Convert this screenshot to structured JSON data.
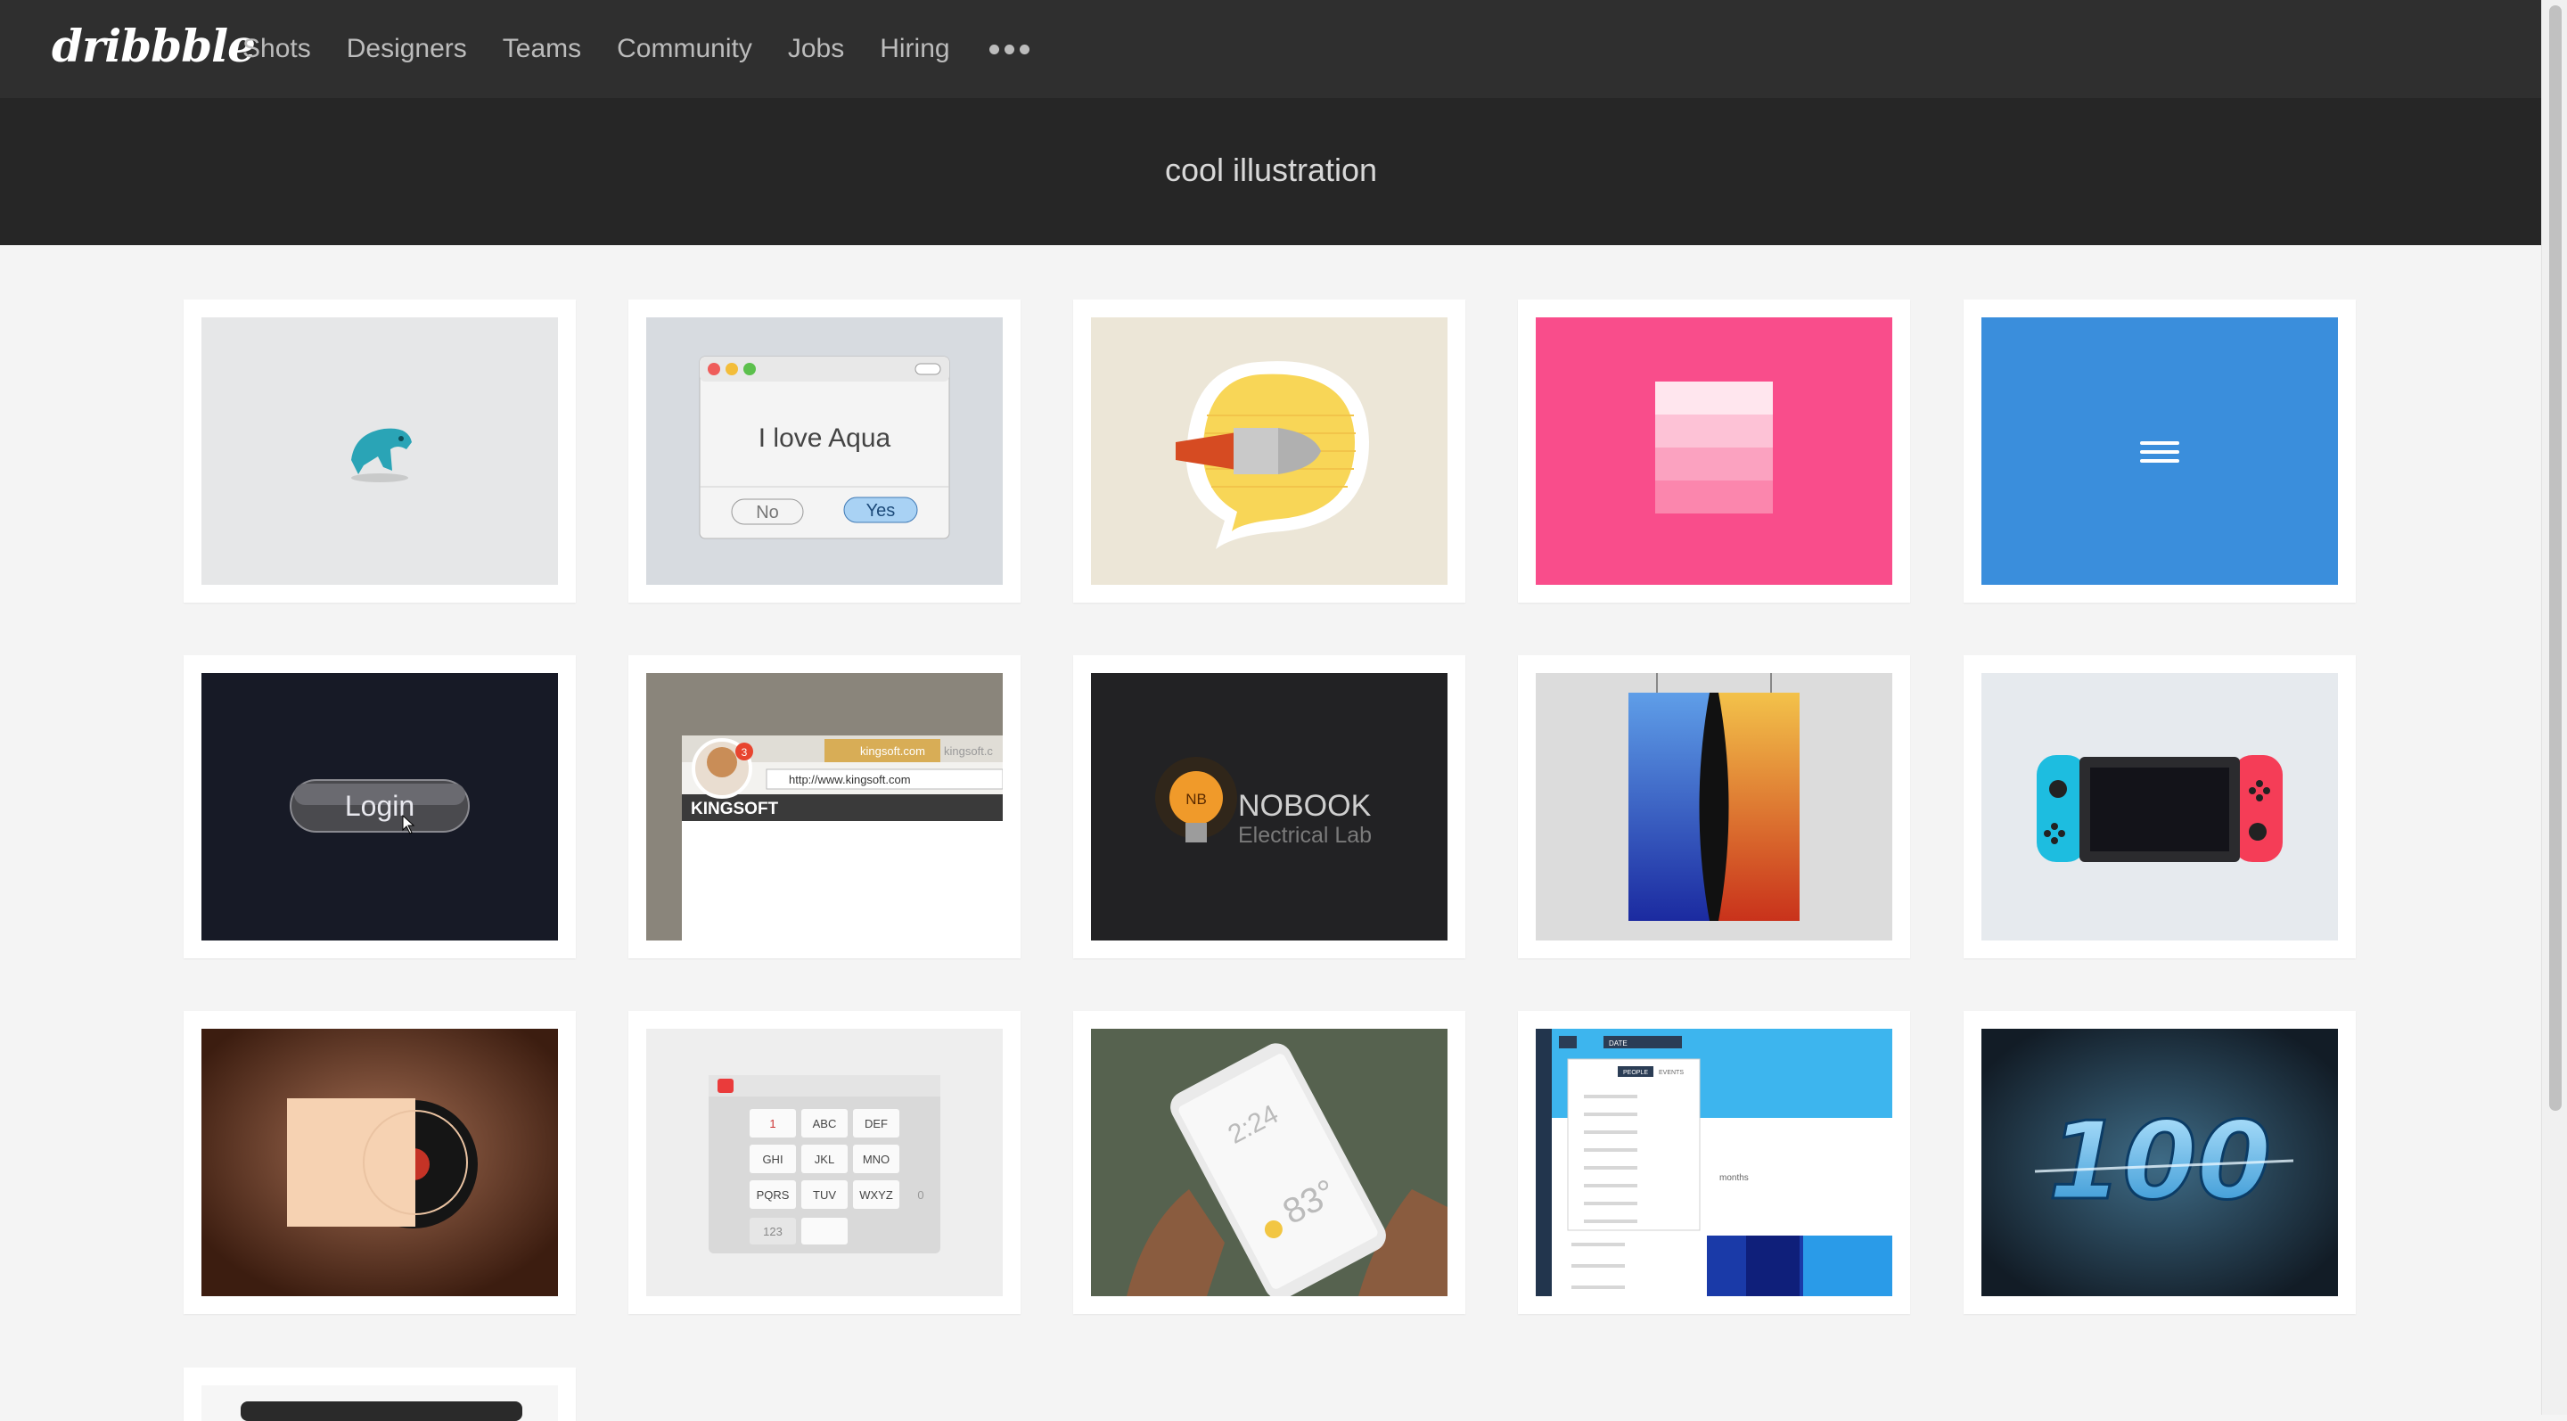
{
  "app": {
    "logo": "dribbble"
  },
  "nav": {
    "items": [
      "Shots",
      "Designers",
      "Teams",
      "Community",
      "Jobs",
      "Hiring"
    ],
    "more_icon": "ellipsis-icon"
  },
  "search": {
    "term": "cool illustration"
  },
  "shots": [
    {
      "name": "teal-bird-shot"
    },
    {
      "name": "aqua-dialog-shot",
      "dialog_text": "I love Aqua",
      "no_label": "No",
      "yes_label": "Yes"
    },
    {
      "name": "bullet-speech-bubble-shot"
    },
    {
      "name": "pink-swatch-shot"
    },
    {
      "name": "blue-menu-icon-shot"
    },
    {
      "name": "login-button-shot",
      "button_label": "Login"
    },
    {
      "name": "kingsoft-browser-shot",
      "tab_label": "kingsoft.com",
      "tab2_label": "kingsoft.c",
      "url": "http://www.kingsoft.com",
      "brand": "KINGSOFT",
      "badge": "3"
    },
    {
      "name": "nobook-bulb-shot",
      "bulb_label": "NB",
      "title": "NOBOOK",
      "subtitle": "Electrical Lab"
    },
    {
      "name": "gradient-poster-shot"
    },
    {
      "name": "switch-console-shot"
    },
    {
      "name": "vinyl-record-shot"
    },
    {
      "name": "phone-keypad-shot",
      "keys": [
        "1",
        "ABC",
        "DEF",
        "GHI",
        "JKL",
        "MNO",
        "PQRS",
        "TUV",
        "WXYZ"
      ],
      "sym": "123",
      "zero": "0"
    },
    {
      "name": "weather-phone-shot",
      "time": "2:24",
      "temp": "83°"
    },
    {
      "name": "analytics-dashboard-shot",
      "tab_people": "PEOPLE",
      "tab_events": "EVENTS",
      "date_label": "DATE",
      "months": "months"
    },
    {
      "name": "100-3d-text-shot",
      "text": "100"
    }
  ],
  "colors": {
    "nav_bg": "#2f2f2f",
    "search_bg": "#262626",
    "page_bg": "#f4f4f4",
    "pink": "#f94d8b",
    "blue": "#3a8edc"
  }
}
